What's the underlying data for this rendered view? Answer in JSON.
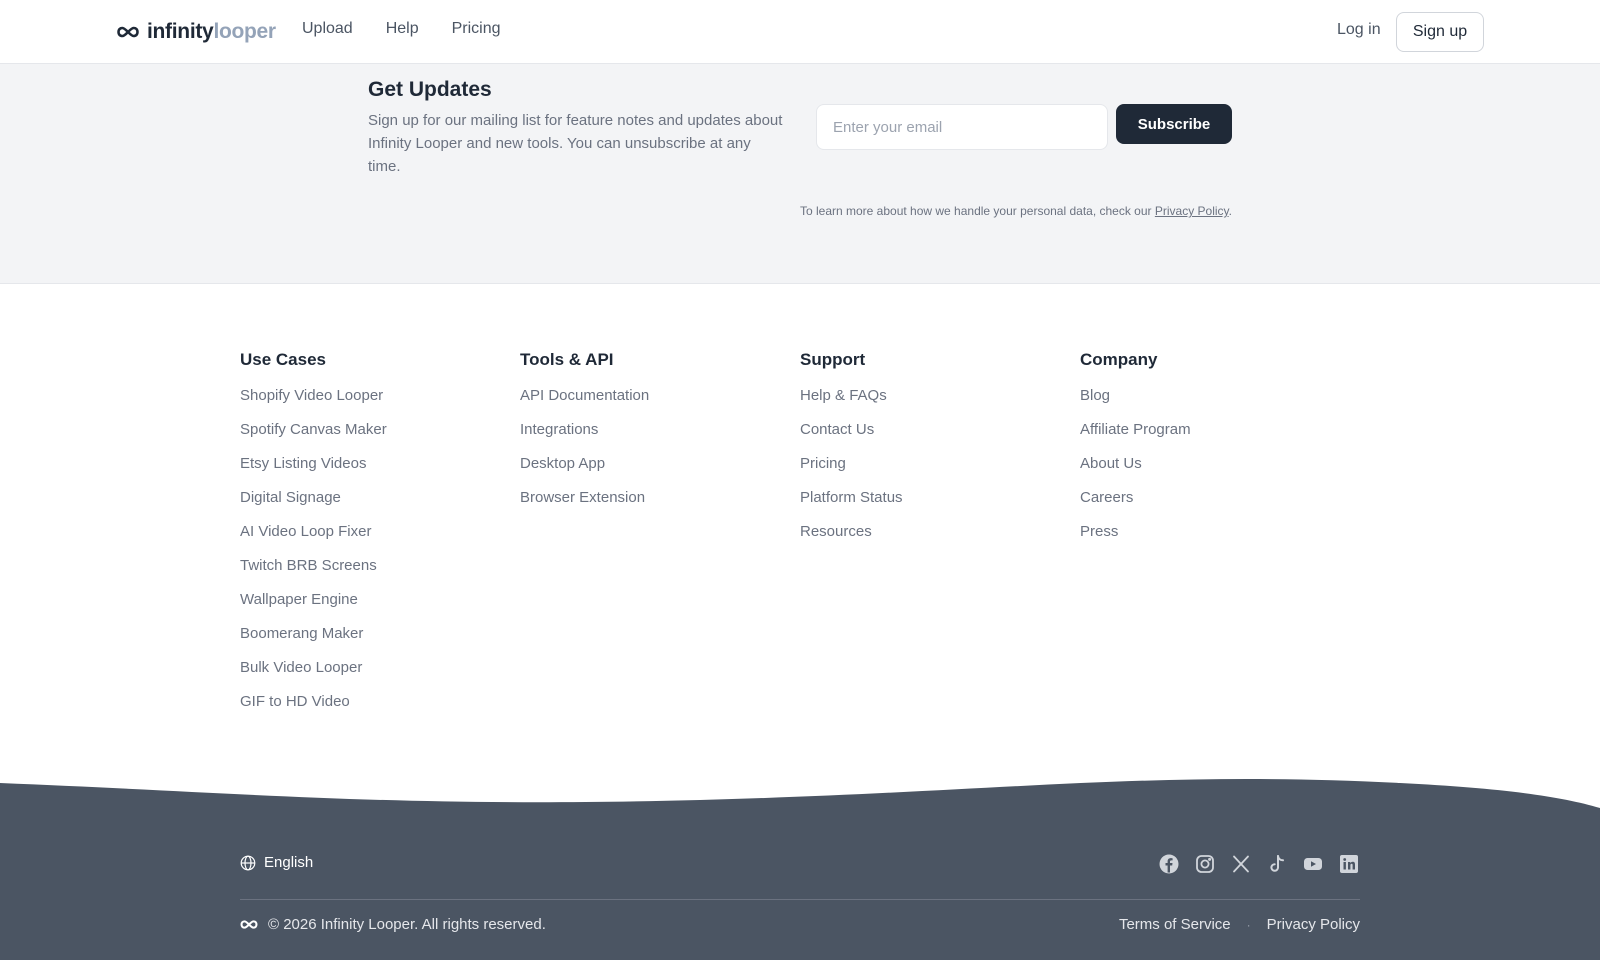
{
  "header": {
    "logo_part1": "infinity",
    "logo_part2": "looper",
    "nav": [
      "Upload",
      "Help",
      "Pricing"
    ],
    "login": "Log in",
    "signup": "Sign up"
  },
  "updates": {
    "title": "Get Updates",
    "description": "Sign up for our mailing list for feature notes and updates about Infinity Looper and new tools. You can unsubscribe at any time.",
    "email_placeholder": "Enter your email",
    "subscribe_label": "Subscribe",
    "privacy_text": "To learn more about how we handle your personal data, check our ",
    "privacy_link": "Privacy Policy",
    "privacy_end": "."
  },
  "footer_columns": [
    {
      "title": "Use Cases",
      "items": [
        "Shopify Video Looper",
        "Spotify Canvas Maker",
        "Etsy Listing Videos",
        "Digital Signage",
        "AI Video Loop Fixer",
        "Twitch BRB Screens",
        "Wallpaper Engine",
        "Boomerang Maker",
        "Bulk Video Looper",
        "GIF to HD Video"
      ]
    },
    {
      "title": "Tools & API",
      "items": [
        "API Documentation",
        "Integrations",
        "Desktop App",
        "Browser Extension"
      ]
    },
    {
      "title": "Support",
      "items": [
        "Help & FAQs",
        "Contact Us",
        "Pricing",
        "Platform Status",
        "Resources"
      ]
    },
    {
      "title": "Company",
      "items": [
        "Blog",
        "Affiliate Program",
        "About Us",
        "Careers",
        "Press"
      ]
    }
  ],
  "bottom": {
    "language": "English",
    "socials": [
      "facebook-icon",
      "instagram-icon",
      "x-icon",
      "tiktok-icon",
      "youtube-icon",
      "linkedin-icon"
    ],
    "copyright": "© 2026 Infinity Looper. All rights reserved.",
    "terms": "Terms of Service",
    "privacy": "Privacy Policy",
    "dark_bg": "#4b5563"
  }
}
